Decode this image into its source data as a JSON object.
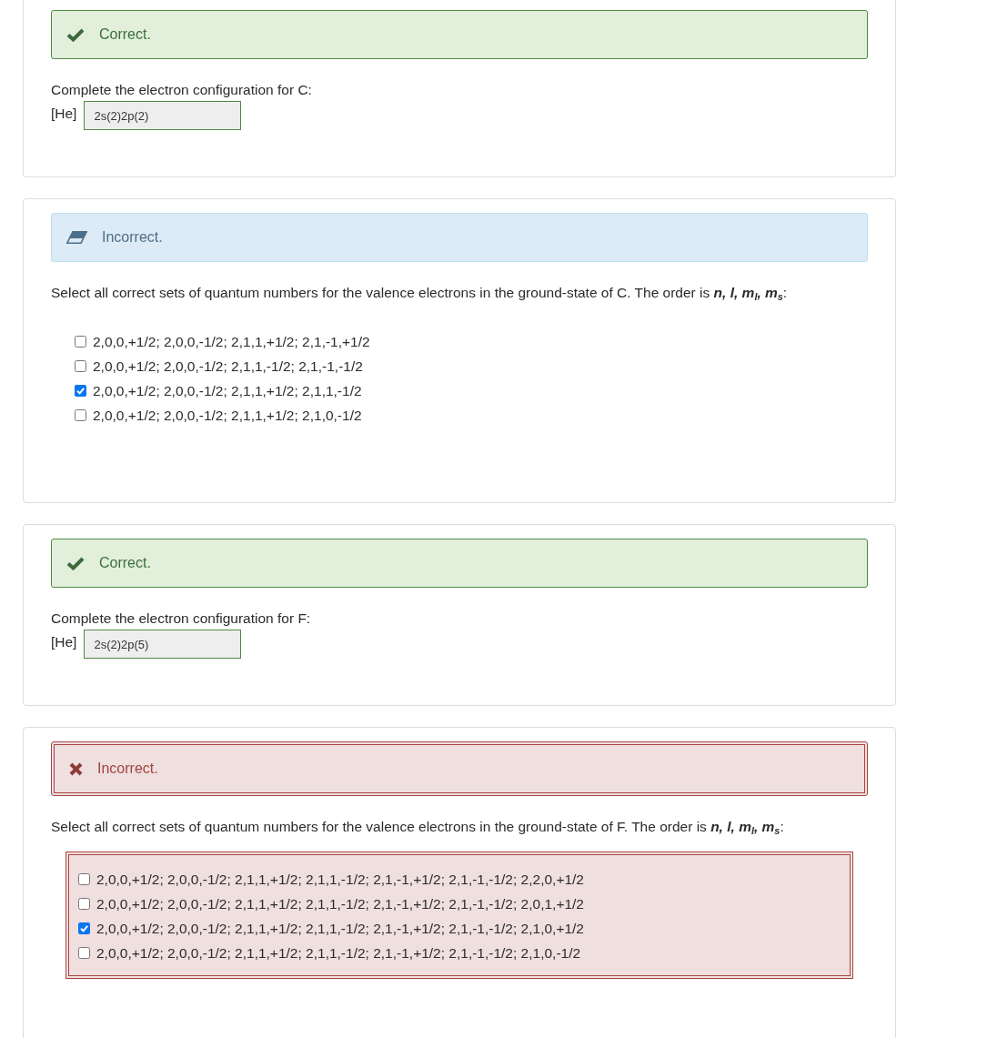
{
  "questions": [
    {
      "kind": "fill_in",
      "feedback": {
        "kind": "correct",
        "text": "Correct."
      },
      "prompt": "Complete the electron configuration for C:",
      "prefix": "[He]",
      "answer": {
        "value": "2s(2)2p(2)",
        "correct": true
      }
    },
    {
      "kind": "multi_select",
      "feedback": {
        "kind": "info",
        "text": "Incorrect."
      },
      "prompt": "Select all correct sets of quantum numbers for the valence electrons in the ground-state of C. The order is **n, l, m**$_{l}$**, m**$_{s}$:",
      "options_incorrect": false,
      "options": [
        {
          "label": "2,0,0,+1/2; 2,0,0,-1/2; 2,1,1,+1/2; 2,1,-1,+1/2",
          "checked": false
        },
        {
          "label": "2,0,0,+1/2; 2,0,0,-1/2; 2,1,1,-1/2; 2,1,-1,-1/2",
          "checked": false
        },
        {
          "label": "2,0,0,+1/2; 2,0,0,-1/2; 2,1,1,+1/2; 2,1,1,-1/2",
          "checked": true
        },
        {
          "label": "2,0,0,+1/2; 2,0,0,-1/2; 2,1,1,+1/2; 2,1,0,-1/2",
          "checked": false
        }
      ]
    },
    {
      "kind": "fill_in",
      "feedback": {
        "kind": "correct",
        "text": "Correct."
      },
      "prompt": "Complete the electron configuration for F:",
      "prefix": "[He]",
      "answer": {
        "value": "2s(2)2p(5)",
        "correct": true
      }
    },
    {
      "kind": "multi_select",
      "feedback": {
        "kind": "incorrect",
        "text": "Incorrect."
      },
      "prompt": "Select all correct sets of quantum numbers for the valence electrons in the ground-state of F. The order is **n, l, m**$_{l}$**, m**$_{s}$:",
      "options_incorrect": true,
      "options": [
        {
          "label": "2,0,0,+1/2; 2,0,0,-1/2; 2,1,1,+1/2; 2,1,1,-1/2; 2,1,-1,+1/2; 2,1,-1,-1/2; 2,2,0,+1/2",
          "checked": false
        },
        {
          "label": "2,0,0,+1/2; 2,0,0,-1/2; 2,1,1,+1/2; 2,1,1,-1/2; 2,1,-1,+1/2; 2,1,-1,-1/2; 2,0,1,+1/2",
          "checked": false
        },
        {
          "label": "2,0,0,+1/2; 2,0,0,-1/2; 2,1,1,+1/2; 2,1,1,-1/2; 2,1,-1,+1/2; 2,1,-1,-1/2; 2,1,0,+1/2",
          "checked": true
        },
        {
          "label": "2,0,0,+1/2; 2,0,0,-1/2; 2,1,1,+1/2; 2,1,1,-1/2; 2,1,-1,+1/2; 2,1,-1,-1/2; 2,1,0,-1/2",
          "checked": false
        }
      ]
    }
  ]
}
